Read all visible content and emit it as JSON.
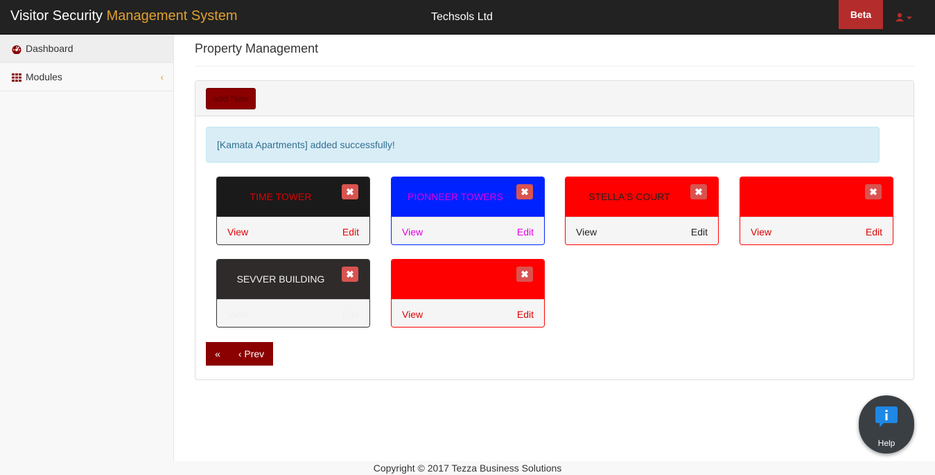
{
  "navbar": {
    "brand_main": "Visitor Security ",
    "brand_accent": "Management System",
    "company": "Techsols Ltd",
    "beta_label": "Beta",
    "user_icon": "user-icon"
  },
  "sidebar": {
    "items": [
      {
        "label": "Dashboard",
        "icon": "dashboard-icon"
      },
      {
        "label": "Modules",
        "icon": "grid-icon",
        "chevron": "‹"
      }
    ]
  },
  "main": {
    "title": "Property Management",
    "add_label": "add New",
    "alert": "[Kamata Apartments] added successfully!",
    "properties": [
      {
        "name": "TIME TOWER",
        "view": "View",
        "edit": "Edit",
        "bg": "#1a1a1a",
        "name_color": "#e00000",
        "link_color": "#e00000",
        "border": "#333333",
        "close": "✖"
      },
      {
        "name": "PIONNEER TOWERS",
        "view": "View",
        "edit": "Edit",
        "bg": "#0022ff",
        "name_color": "#e000e0",
        "link_color": "#e000e0",
        "border": "#0022ff",
        "close": "✖"
      },
      {
        "name": "STELLA'S COURT",
        "view": "View",
        "edit": "Edit",
        "bg": "#ff0000",
        "name_color": "#222222",
        "link_color": "#222222",
        "border": "#ff0000",
        "close": "✖"
      },
      {
        "name": "",
        "view": "View",
        "edit": "Edit",
        "bg": "#ff0000",
        "name_color": "#ff0000",
        "link_color": "#e00000",
        "border": "#ff0000",
        "close": "✖"
      },
      {
        "name": "SEVVER BUILDING",
        "view": "View",
        "edit": "Edit",
        "bg": "#2f2b2b",
        "name_color": "#f0f0f0",
        "link_color": "#f0f0f0",
        "border": "#333333",
        "close": "✖"
      },
      {
        "name": "",
        "view": "View",
        "edit": "Edit",
        "bg": "#ff0000",
        "name_color": "#ff0000",
        "link_color": "#e00000",
        "border": "#ff0000",
        "close": "✖"
      }
    ],
    "pager": {
      "first": "«",
      "prev": "‹ Prev"
    }
  },
  "footer": {
    "copyright": "Copyright © 2017 Tezza Business Solutions"
  },
  "help": {
    "label": "Help",
    "icon": "info-icon"
  },
  "colors": {
    "accent": "#e0a030",
    "brand_red": "#8b0000",
    "beta": "#b52c2c"
  }
}
